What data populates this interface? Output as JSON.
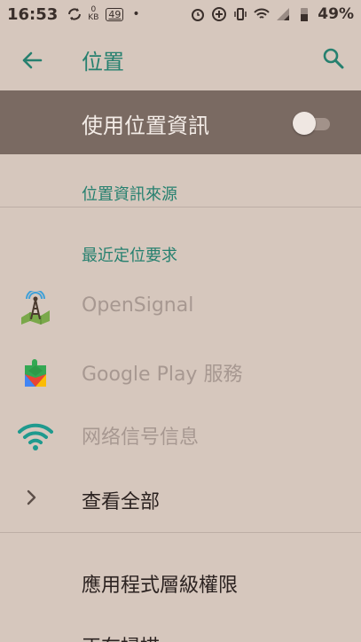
{
  "status_bar": {
    "time": "16:53",
    "data_speed_value": "0",
    "data_speed_unit": "KB",
    "notification_badge": "49",
    "dot": "•",
    "battery_percent": "49%",
    "icons": [
      "sync-icon",
      "alarm-icon",
      "data-saver-icon",
      "vibrate-icon",
      "wifi-icon",
      "signal-icon",
      "battery-icon"
    ]
  },
  "toolbar": {
    "title": "位置",
    "back_icon": "arrow-left-icon",
    "search_icon": "search-icon"
  },
  "master_switch": {
    "label": "使用位置資訊",
    "enabled": false
  },
  "sections": {
    "sources_header": "位置資訊來源",
    "recent_header": "最近定位要求"
  },
  "recent_apps": [
    {
      "name": "OpenSignal",
      "icon": "opensignal-app-icon"
    },
    {
      "name": "Google Play 服務",
      "icon": "google-play-services-icon"
    },
    {
      "name": "网络信号信息",
      "icon": "wifi-signal-app-icon"
    }
  ],
  "view_all": {
    "label": "查看全部",
    "icon": "chevron-right-icon"
  },
  "more_rows": [
    {
      "label": "應用程式層級權限"
    },
    {
      "label": "正在掃描"
    }
  ],
  "colors": {
    "background": "#d6c7bd",
    "accent": "#26806f",
    "master_bar": "#7a6a62"
  }
}
